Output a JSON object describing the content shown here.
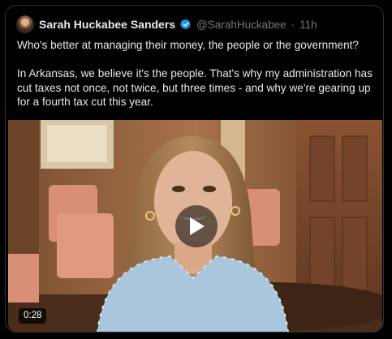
{
  "tweet": {
    "author_name": "Sarah Huckabee Sanders",
    "handle": "@SarahHuckabee",
    "separator": "·",
    "time": "11h",
    "verified": true,
    "paragraphs": [
      "Who's better at managing their money, the people or the government?",
      "In Arkansas, we believe it's the people. That's why my administration has cut taxes not once, not twice, but three times - and why we're gearing up for a fourth tax cut this year."
    ]
  },
  "video": {
    "duration": "0:28",
    "icons": [
      "play-icon"
    ]
  },
  "colors": {
    "background": "#000000",
    "border": "#2f3336",
    "text": "#e7e9ea",
    "muted": "#71767b",
    "verified": "#1d9bf0"
  }
}
